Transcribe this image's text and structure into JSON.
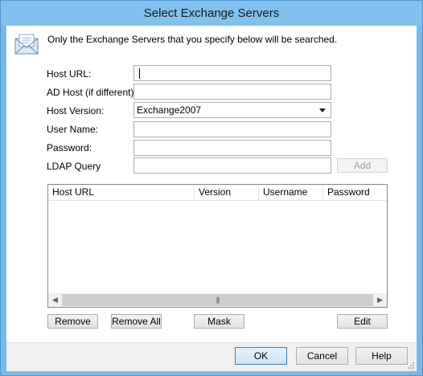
{
  "window": {
    "title": "Select Exchange Servers"
  },
  "header": {
    "icon": "mail-envelope-icon",
    "intro_text": "Only the Exchange Servers that you specify below will be searched."
  },
  "form": {
    "host_url": {
      "label": "Host URL:",
      "value": ""
    },
    "ad_host": {
      "label": "AD Host (if different):",
      "value": ""
    },
    "host_version": {
      "label": "Host Version:",
      "value": "Exchange2007"
    },
    "user_name": {
      "label": "User Name:",
      "value": ""
    },
    "password": {
      "label": "Password:",
      "value": ""
    },
    "ldap_query": {
      "label": "LDAP Query",
      "value": ""
    },
    "add_label": "Add"
  },
  "server_list": {
    "columns": [
      "Host URL",
      "Version",
      "Username",
      "Password"
    ],
    "rows": []
  },
  "list_buttons": {
    "remove": "Remove",
    "remove_all": "Remove All",
    "mask": "Mask",
    "edit": "Edit"
  },
  "dialog_buttons": {
    "ok": "OK",
    "cancel": "Cancel",
    "help": "Help"
  }
}
